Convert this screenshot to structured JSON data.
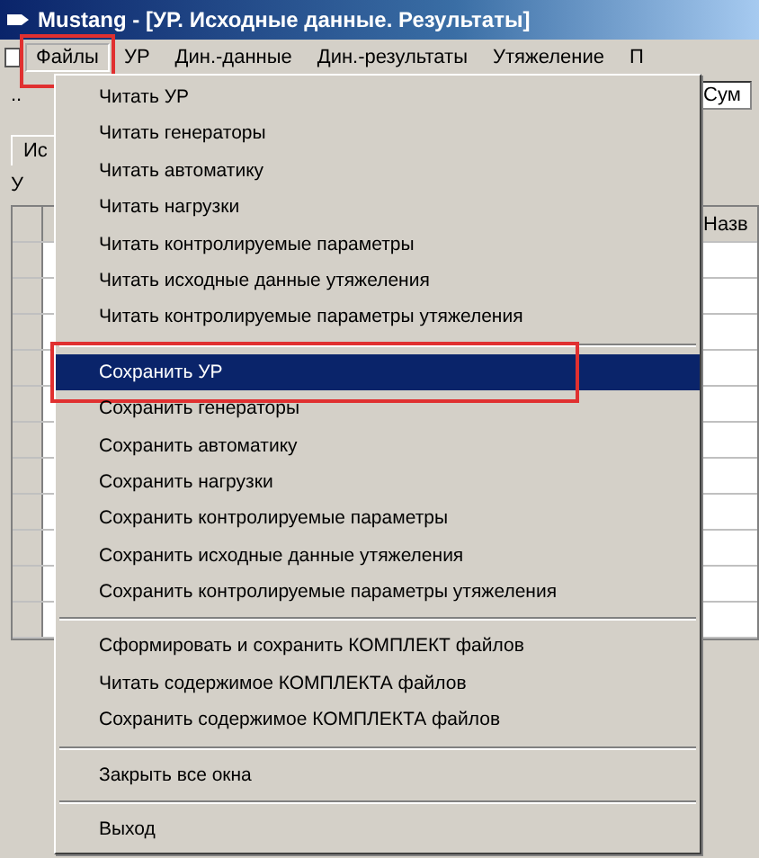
{
  "window": {
    "title": "Mustang - [УР. Исходные данные. Результаты]"
  },
  "menu_bar": [
    {
      "label": "Файлы",
      "selected": true,
      "highlighted": true
    },
    {
      "label": "УР",
      "selected": false,
      "highlighted": false
    },
    {
      "label": "Дин.-данные",
      "selected": false,
      "highlighted": false
    },
    {
      "label": "Дин.-результаты",
      "selected": false,
      "highlighted": false
    },
    {
      "label": "Утяжеление",
      "selected": false,
      "highlighted": false
    },
    {
      "label": "П",
      "selected": false,
      "highlighted": false
    }
  ],
  "workspace": {
    "toolbar_text": "..",
    "field_value": "Сум",
    "tab_label": "Ис",
    "section_label": "У",
    "column_header": "Назв"
  },
  "menu": {
    "items": [
      {
        "kind": "item",
        "label": "Читать УР",
        "selected": false,
        "highlighted": false
      },
      {
        "kind": "item",
        "label": "Читать генераторы",
        "selected": false,
        "highlighted": false
      },
      {
        "kind": "item",
        "label": "Читать автоматику",
        "selected": false,
        "highlighted": false
      },
      {
        "kind": "item",
        "label": "Читать нагрузки",
        "selected": false,
        "highlighted": false
      },
      {
        "kind": "item",
        "label": "Читать контролируемые параметры",
        "selected": false,
        "highlighted": false
      },
      {
        "kind": "item",
        "label": "Читать исходные данные утяжеления",
        "selected": false,
        "highlighted": false
      },
      {
        "kind": "item",
        "label": "Читать контролируемые параметры утяжеления",
        "selected": false,
        "highlighted": false
      },
      {
        "kind": "separator"
      },
      {
        "kind": "item",
        "label": "Сохранить УР",
        "selected": true,
        "highlighted": true
      },
      {
        "kind": "item",
        "label": "Сохранить генераторы",
        "selected": false,
        "highlighted": false
      },
      {
        "kind": "item",
        "label": "Сохранить автоматику",
        "selected": false,
        "highlighted": false
      },
      {
        "kind": "item",
        "label": "Сохранить нагрузки",
        "selected": false,
        "highlighted": false
      },
      {
        "kind": "item",
        "label": "Сохранить контролируемые параметры",
        "selected": false,
        "highlighted": false
      },
      {
        "kind": "item",
        "label": "Сохранить исходные данные утяжеления",
        "selected": false,
        "highlighted": false
      },
      {
        "kind": "item",
        "label": "Сохранить контролируемые параметры утяжеления",
        "selected": false,
        "highlighted": false
      },
      {
        "kind": "separator"
      },
      {
        "kind": "item",
        "label": "Сформировать и сохранить КОМПЛЕКТ файлов",
        "selected": false,
        "highlighted": false
      },
      {
        "kind": "item",
        "label": "Читать содержимое КОМПЛЕКТА файлов",
        "selected": false,
        "highlighted": false
      },
      {
        "kind": "item",
        "label": "Сохранить содержимое КОМПЛЕКТА файлов",
        "selected": false,
        "highlighted": false
      },
      {
        "kind": "separator"
      },
      {
        "kind": "item",
        "label": "Закрыть все окна",
        "selected": false,
        "highlighted": false
      },
      {
        "kind": "separator"
      },
      {
        "kind": "item",
        "label": "Выход",
        "selected": false,
        "highlighted": false
      }
    ]
  }
}
